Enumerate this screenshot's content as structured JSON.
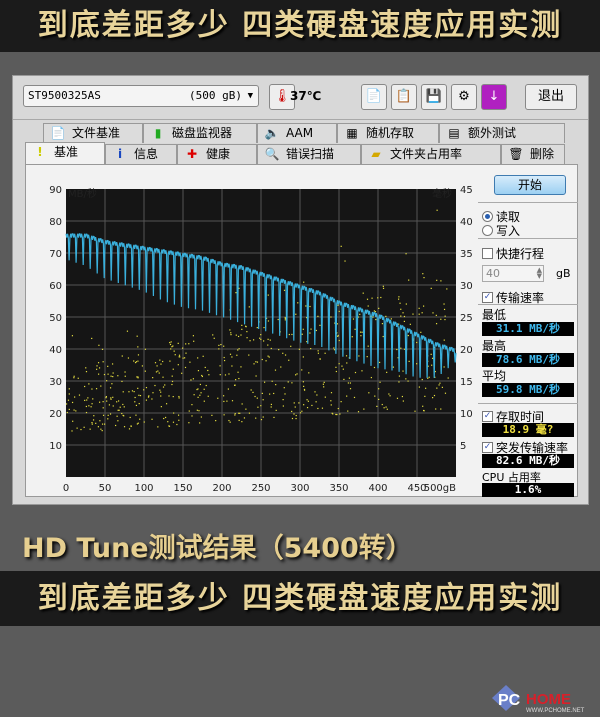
{
  "banner_title": "到底差距多少 四类硬盘速度应用实测",
  "caption": "HD Tune测试结果（5400转）",
  "logo": {
    "text": "PCHOME",
    "url_text": "WWW.PCHOME.NET"
  },
  "toolbar": {
    "drive": "ST9500325AS",
    "capacity": "(500 gB)",
    "temperature": "37℃",
    "exit_label": "退出",
    "buttons": [
      "copy-text-icon",
      "copy-image-icon",
      "save-icon",
      "options-icon",
      "download-icon"
    ]
  },
  "tabs_top": [
    {
      "label": "文件基准",
      "icon": "file-benchmark-icon"
    },
    {
      "label": "磁盘监视器",
      "icon": "disk-monitor-icon"
    },
    {
      "label": "AAM",
      "icon": "speaker-icon"
    },
    {
      "label": "随机存取",
      "icon": "random-access-icon"
    },
    {
      "label": "额外测试",
      "icon": "extra-tests-icon"
    }
  ],
  "tabs_bottom": [
    {
      "label": "基准",
      "icon": "benchmark-icon",
      "active": true
    },
    {
      "label": "信息",
      "icon": "info-icon"
    },
    {
      "label": "健康",
      "icon": "health-icon"
    },
    {
      "label": "错误扫描",
      "icon": "error-scan-icon"
    },
    {
      "label": "文件夹占用率",
      "icon": "folder-usage-icon"
    },
    {
      "label": "删除",
      "icon": "trash-icon"
    }
  ],
  "side": {
    "start_label": "开始",
    "read_label": "读取",
    "write_label": "写入",
    "read_selected": true,
    "short_stroke_label": "快捷行程",
    "short_stroke_checked": false,
    "short_stroke_value": "40",
    "short_stroke_unit": "gB",
    "transfer_rate_label": "传输速率",
    "transfer_rate_checked": true,
    "min_label": "最低",
    "min_value": "31.1 MB/秒",
    "max_label": "最高",
    "max_value": "78.6 MB/秒",
    "avg_label": "平均",
    "avg_value": "59.8 MB/秒",
    "access_time_label": "存取时间",
    "access_time_checked": true,
    "access_time_value": "18.9 毫?",
    "burst_label": "突发传输速率",
    "burst_checked": true,
    "burst_value": "82.6 MB/秒",
    "cpu_label": "CPU 占用率",
    "cpu_value": "1.6%"
  },
  "chart_data": {
    "type": "line",
    "ylabel_left": "MB/秒",
    "ylabel_right": "毫秒",
    "xlim": [
      0,
      500
    ],
    "ylim_left": [
      0,
      90
    ],
    "ylim_right": [
      0,
      45
    ],
    "x_ticks": [
      "0",
      "50",
      "100",
      "150",
      "200",
      "250",
      "300",
      "350",
      "400",
      "450",
      "500gB"
    ],
    "y_ticks_left": [
      "10",
      "20",
      "30",
      "40",
      "50",
      "60",
      "70",
      "80",
      "90"
    ],
    "y_ticks_right": [
      "5",
      "10",
      "15",
      "20",
      "25",
      "30",
      "35",
      "40",
      "45"
    ],
    "series": [
      {
        "name": "transfer rate upper (MB/s)",
        "color": "#3ab0dc",
        "x": [
          0,
          25,
          50,
          75,
          100,
          125,
          150,
          175,
          200,
          225,
          250,
          275,
          300,
          325,
          350,
          375,
          400,
          425,
          450,
          475,
          500
        ],
        "values": [
          76,
          76,
          74,
          73,
          72,
          71,
          70,
          69,
          67,
          66,
          64,
          62,
          60,
          58,
          55,
          53,
          51,
          48,
          45,
          42,
          40
        ]
      },
      {
        "name": "transfer rate dips (MB/s)",
        "color": "#3ab0dc",
        "x": [
          0,
          25,
          50,
          75,
          100,
          125,
          150,
          175,
          200,
          225,
          250,
          275,
          300,
          325,
          350,
          375,
          400,
          425,
          450,
          475,
          500
        ],
        "values": [
          68,
          66,
          62,
          60,
          58,
          55,
          53,
          52,
          50,
          48,
          46,
          44,
          42,
          41,
          38,
          36,
          34,
          33,
          31,
          31,
          36
        ]
      },
      {
        "name": "access time (ms)",
        "color": "#e8e040",
        "type": "scatter",
        "range_ms": [
          5,
          25
        ],
        "typical_ms": 18.9
      }
    ]
  }
}
